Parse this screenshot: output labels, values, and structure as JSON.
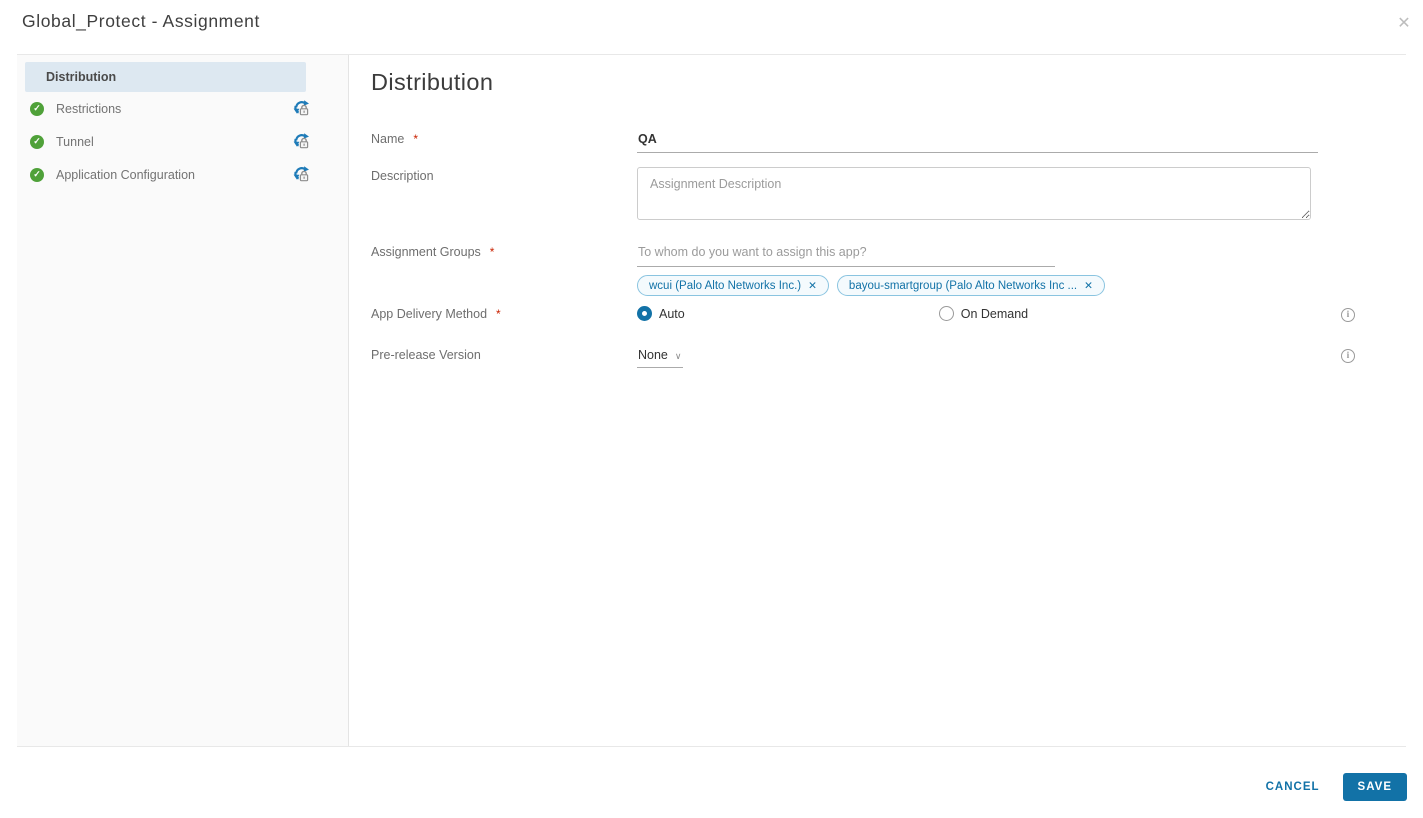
{
  "window": {
    "title": "Global_Protect - Assignment"
  },
  "icons": {
    "close": "✕",
    "check": "✓",
    "chip_remove": "✕",
    "chevron_down": "∨",
    "info": "i"
  },
  "sidebar": {
    "steps": [
      {
        "label": "Distribution",
        "state": "selected"
      },
      {
        "label": "Restrictions",
        "state": "completed-locked"
      },
      {
        "label": "Tunnel",
        "state": "completed-locked"
      },
      {
        "label": "Application Configuration",
        "state": "completed-locked"
      }
    ]
  },
  "form": {
    "heading": "Distribution",
    "name": {
      "label": "Name",
      "required_mark": "*",
      "value": "QA"
    },
    "description": {
      "label": "Description",
      "placeholder": "Assignment Description"
    },
    "assignment_groups": {
      "label": "Assignment Groups",
      "required_mark": "*",
      "placeholder": "To whom do you want to assign this app?",
      "chips": [
        {
          "label": "wcui (Palo Alto Networks Inc.)"
        },
        {
          "label": "bayou-smartgroup (Palo Alto Networks Inc ..."
        }
      ]
    },
    "app_delivery_method": {
      "label": "App Delivery Method",
      "required_mark": "*",
      "options": [
        {
          "label": "Auto",
          "selected": true
        },
        {
          "label": "On Demand",
          "selected": false
        }
      ],
      "selected": "Auto"
    },
    "prerelease_version": {
      "label": "Pre-release Version",
      "value": "None"
    }
  },
  "footer": {
    "cancel": "CANCEL",
    "save": "SAVE"
  },
  "colors": {
    "accent_blue": "#1272a7",
    "success_green": "#4fa139",
    "selected_step_bg": "#dde8f1",
    "chip_border": "#8ac4e0",
    "chip_bg": "#f4fafd",
    "required_red": "#c92100",
    "sidebar_bg": "#fafafa"
  }
}
